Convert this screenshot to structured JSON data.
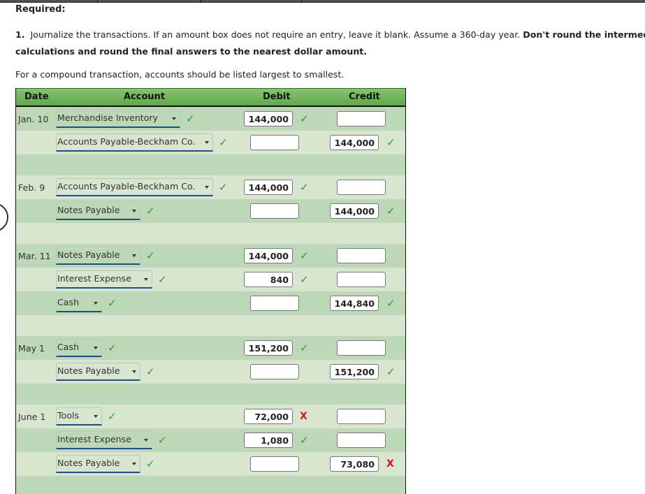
{
  "header": {
    "required": "Required:",
    "instruction_number": "1.",
    "instruction_text": "Journalize the transactions. If an amount box does not require an entry, leave it blank. Assume a 360-day year.",
    "instruction_bold": "Don't round the intermediate calculations and round the final answers to the nearest dollar amount.",
    "instruction_bold_line1": "Don't round the intermediate",
    "instruction_bold_line2": "calculations and round the final answers to the nearest dollar amount.",
    "compound_note": "For a compound transaction, accounts should be listed largest to smallest."
  },
  "table": {
    "columns": [
      "Date",
      "Account",
      "Debit",
      "Credit"
    ],
    "colors": {
      "check": "#2c9a3c",
      "cross": "#e01010",
      "row_dark": "#bcd8b6",
      "row_light": "#d8e6d0",
      "header": "#6fb55a"
    },
    "rows": [
      {
        "date": "Jan. 10",
        "account": "Merchandise Inventory",
        "account_status": "correct",
        "debit": "144,000",
        "debit_status": "correct",
        "credit": "",
        "credit_status": ""
      },
      {
        "date": "",
        "account": "Accounts Payable-Beckham Co.",
        "account_status": "correct",
        "debit": "",
        "debit_status": "",
        "credit": "144,000",
        "credit_status": "correct"
      },
      {
        "date": "Feb. 9",
        "account": "Accounts Payable-Beckham Co.",
        "account_status": "correct",
        "debit": "144,000",
        "debit_status": "correct",
        "credit": "",
        "credit_status": ""
      },
      {
        "date": "",
        "account": "Notes Payable",
        "account_status": "correct",
        "debit": "",
        "debit_status": "",
        "credit": "144,000",
        "credit_status": "correct"
      },
      {
        "date": "Mar. 11",
        "account": "Notes Payable",
        "account_status": "correct",
        "debit": "144,000",
        "debit_status": "correct",
        "credit": "",
        "credit_status": ""
      },
      {
        "date": "",
        "account": "Interest Expense",
        "account_status": "correct",
        "debit": "840",
        "debit_status": "correct",
        "credit": "",
        "credit_status": ""
      },
      {
        "date": "",
        "account": "Cash",
        "account_status": "correct",
        "debit": "",
        "debit_status": "",
        "credit": "144,840",
        "credit_status": "correct"
      },
      {
        "date": "May 1",
        "account": "Cash",
        "account_status": "correct",
        "debit": "151,200",
        "debit_status": "correct",
        "credit": "",
        "credit_status": ""
      },
      {
        "date": "",
        "account": "Notes Payable",
        "account_status": "correct",
        "debit": "",
        "debit_status": "",
        "credit": "151,200",
        "credit_status": "correct"
      },
      {
        "date": "June 1",
        "account": "Tools",
        "account_status": "correct",
        "debit": "72,000",
        "debit_status": "incorrect",
        "credit": "",
        "credit_status": ""
      },
      {
        "date": "",
        "account": "Interest Expense",
        "account_status": "correct",
        "debit": "1,080",
        "debit_status": "correct",
        "credit": "",
        "credit_status": ""
      },
      {
        "date": "",
        "account": "Notes Payable",
        "account_status": "correct",
        "debit": "",
        "debit_status": "",
        "credit": "73,080",
        "credit_status": "incorrect"
      }
    ]
  },
  "icons": {
    "correct": "✓",
    "incorrect": "X"
  }
}
